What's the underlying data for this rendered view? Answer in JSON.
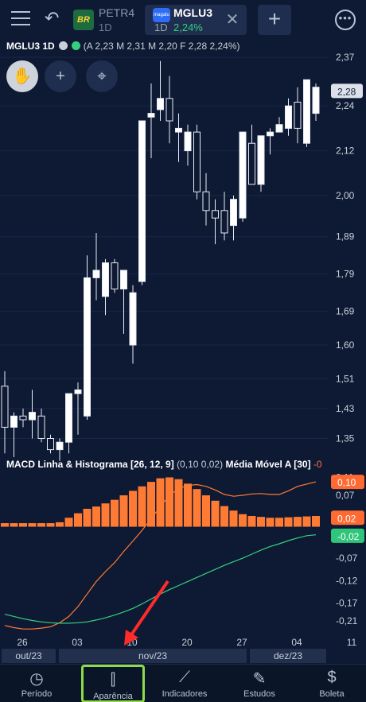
{
  "topbar": {
    "tabs": [
      {
        "symbol": "PETR4",
        "timeframe": "1D",
        "logo_text": "BR"
      },
      {
        "symbol": "MGLU3",
        "timeframe": "1D",
        "change": "2,24%",
        "logo_text": "magalu"
      }
    ]
  },
  "legend": {
    "symbol": "MGLU3 1D",
    "values": "(A 2,23 M 2,31 M 2,20 F 2,28 2,24%)"
  },
  "tools": [
    "hand-icon",
    "crosshair-icon",
    "target-icon"
  ],
  "price_axis": {
    "labels": [
      "2,37",
      "2,24",
      "2,12",
      "2,00",
      "1,89",
      "1,79",
      "1,69",
      "1,60",
      "1,51",
      "1,43",
      "1,35"
    ],
    "last_price": "2,28"
  },
  "macd_legend": {
    "title": "MACD Linha & Histograma [26, 12, 9]",
    "values": "(0,10 0,02)",
    "ma_title": "Média Móvel A [30]",
    "ma_value": "-0"
  },
  "macd_axis": {
    "labels": [
      "0,11",
      "0,07",
      "0,02",
      "-0,02",
      "-0,07",
      "-0,12",
      "-0,17",
      "-0,21"
    ],
    "badges": [
      "0,10",
      "0,02",
      "-0,02"
    ]
  },
  "time_axis": {
    "labels": [
      "26",
      "03",
      "10",
      "20",
      "27",
      "04",
      "11"
    ],
    "months": [
      "out/23",
      "nov/23",
      "dez/23"
    ]
  },
  "nav": [
    {
      "label": "Período",
      "icon": "clock-icon"
    },
    {
      "label": "Aparência",
      "icon": "candles-icon"
    },
    {
      "label": "Indicadores",
      "icon": "indicators-icon"
    },
    {
      "label": "Estudos",
      "icon": "pencil-icon"
    },
    {
      "label": "Boleta",
      "icon": "dollar-icon"
    }
  ],
  "colors": {
    "background": "#0e1a33",
    "histogram": "#ff7a33",
    "macd_line": "#ff7a33",
    "signal_line": "#35d07f",
    "highlight": "#8bdb4a",
    "arrow": "#ff2a2a"
  },
  "chart_data": {
    "type": "candlestick",
    "x": [
      "26",
      "",
      "",
      "",
      "",
      "",
      "03",
      "",
      "",
      "",
      "",
      "",
      "10",
      "",
      "",
      "",
      "",
      "",
      "20",
      "",
      "",
      "",
      "",
      "",
      "27",
      "",
      "",
      "",
      "",
      "",
      "04",
      "",
      "",
      "",
      "",
      "",
      "11",
      "",
      "",
      ""
    ],
    "candles": [
      [
        1.49,
        1.53,
        1.31,
        1.38
      ],
      [
        1.38,
        1.42,
        1.3,
        1.41
      ],
      [
        1.41,
        1.43,
        1.38,
        1.4
      ],
      [
        1.4,
        1.48,
        1.35,
        1.42
      ],
      [
        1.41,
        1.43,
        1.34,
        1.35
      ],
      [
        1.35,
        1.36,
        1.31,
        1.32
      ],
      [
        1.32,
        1.35,
        1.29,
        1.34
      ],
      [
        1.34,
        1.39,
        1.31,
        1.47
      ],
      [
        1.47,
        1.5,
        1.36,
        1.48
      ],
      [
        1.41,
        1.84,
        1.4,
        1.78
      ],
      [
        1.78,
        1.9,
        1.72,
        1.8
      ],
      [
        1.73,
        1.83,
        1.68,
        1.82
      ],
      [
        1.82,
        1.83,
        1.74,
        1.75
      ],
      [
        1.75,
        1.78,
        1.63,
        1.8
      ],
      [
        1.6,
        1.76,
        1.55,
        1.74
      ],
      [
        1.77,
        2.12,
        1.76,
        2.2
      ],
      [
        2.21,
        2.3,
        2.1,
        2.22
      ],
      [
        2.23,
        2.36,
        2.2,
        2.26
      ],
      [
        2.26,
        2.32,
        2.14,
        2.2
      ],
      [
        2.17,
        2.22,
        2.09,
        2.18
      ],
      [
        2.12,
        2.19,
        2.08,
        2.17
      ],
      [
        2.17,
        2.19,
        1.99,
        2.01
      ],
      [
        2.01,
        2.06,
        1.92,
        1.96
      ],
      [
        1.96,
        1.99,
        1.87,
        1.94
      ],
      [
        1.96,
        2.01,
        1.88,
        1.9
      ],
      [
        1.92,
        2.0,
        1.88,
        1.99
      ],
      [
        1.94,
        2.17,
        1.93,
        2.17
      ],
      [
        2.14,
        2.19,
        2.03,
        2.03
      ],
      [
        2.03,
        2.16,
        2.01,
        2.16
      ],
      [
        2.16,
        2.18,
        2.11,
        2.17
      ],
      [
        2.17,
        2.21,
        2.17,
        2.19
      ],
      [
        2.18,
        2.26,
        2.16,
        2.24
      ],
      [
        2.25,
        2.29,
        2.14,
        2.18
      ],
      [
        2.14,
        2.31,
        2.13,
        2.31
      ],
      [
        2.22,
        2.3,
        2.2,
        2.29
      ]
    ],
    "histogram": [
      0.008,
      0.008,
      0.008,
      0.008,
      0.008,
      0.008,
      0.01,
      0.02,
      0.03,
      0.04,
      0.045,
      0.052,
      0.06,
      0.07,
      0.08,
      0.09,
      0.1,
      0.108,
      0.11,
      0.106,
      0.096,
      0.084,
      0.07,
      0.058,
      0.046,
      0.036,
      0.028,
      0.024,
      0.022,
      0.02,
      0.02,
      0.021,
      0.022,
      0.023,
      0.024
    ],
    "macd": [
      -0.22,
      -0.225,
      -0.228,
      -0.228,
      -0.226,
      -0.223,
      -0.214,
      -0.2,
      -0.178,
      -0.15,
      -0.122,
      -0.1,
      -0.08,
      -0.055,
      -0.032,
      -0.008,
      0.018,
      0.045,
      0.07,
      0.085,
      0.092,
      0.094,
      0.09,
      0.082,
      0.072,
      0.068,
      0.07,
      0.073,
      0.074,
      0.072,
      0.072,
      0.08,
      0.09,
      0.095,
      0.1
    ],
    "signal": [
      -0.195,
      -0.2,
      -0.205,
      -0.209,
      -0.212,
      -0.214,
      -0.215,
      -0.215,
      -0.214,
      -0.212,
      -0.208,
      -0.203,
      -0.197,
      -0.19,
      -0.182,
      -0.172,
      -0.161,
      -0.15,
      -0.14,
      -0.131,
      -0.122,
      -0.113,
      -0.104,
      -0.095,
      -0.086,
      -0.078,
      -0.07,
      -0.061,
      -0.052,
      -0.044,
      -0.038,
      -0.031,
      -0.025,
      -0.02,
      -0.018
    ]
  }
}
